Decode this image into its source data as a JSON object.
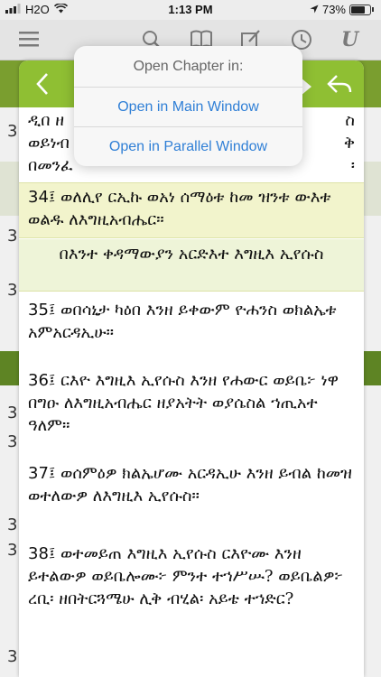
{
  "status": {
    "carrier": "H2O",
    "time": "1:13 PM",
    "battery": "73%"
  },
  "toolbar": {
    "icons": [
      "menu-icon",
      "search-icon",
      "book-icon",
      "edit-icon",
      "history-icon",
      "font-icon"
    ],
    "font_glyph": "U"
  },
  "background": {
    "verse_numbers": [
      "3",
      "3",
      "3",
      "3",
      "3",
      "3",
      "3",
      "3"
    ]
  },
  "panel": {
    "verses": [
      {
        "num": "",
        "text": "ዲበ ዘ… ወይነብ… በመንፈ… ",
        "cut": true
      },
      {
        "num": "34፤",
        "text": "ወለሊየ ርኢኩ ወአነ ሰማዕቱ ከመ ዝንቱ ውእቱ ወልዱ ለእግዚአብሔር።"
      },
      {
        "num": "",
        "text": "በእንተ ቀዳማውያን አርድእተ እግዚእ ኢየሱስ",
        "heading": true
      },
      {
        "num": "35፤",
        "text": "ወበሳኒታ ካዕበ እንዘ ይቀውም ዮሐንስ ወክልኤቱ አምአርዳኢሁ።"
      },
      {
        "num": "36፤",
        "text": "ርእዮ እግዚእ ኢየሱስ እንዘ የሐውር ወይቤ፦ ነዋ በግዑ ለእግዚአብሔር ዘያአትት ወያሴስል ኀጢአተ ዓለም።"
      },
      {
        "num": "37፤",
        "text": "ወሰምዕዎ ክልኤሆሙ አርዳኢሁ እንዘ ይብል ከመዝ ወተለውዎ ለእግዚእ ኢየሱስ።"
      },
      {
        "num": "38፤",
        "text": "ወተመይጠ እግዚእ ኢየሱስ ርእዮሙ እንዘ ይተልውዎ ወይቤሎሙ፦ ምንተ ተኀሥሡ? ወይቤልዎ፦ ረቢ፡ ዘበትርጓሜሁ ሊቅ ብሂል፡ አይቴ ተኀድር?"
      }
    ],
    "cut_line_1": "ዲበ ዘ",
    "cut_line_1_end": "ስ",
    "cut_line_2": "ወይነብ",
    "cut_line_2_end": "ቅ",
    "cut_line_3": "በመንፈ",
    "cut_line_3_end": "፡"
  },
  "popover": {
    "title": "Open Chapter in:",
    "option_main": "Open in Main Window",
    "option_parallel": "Open in Parallel Window"
  },
  "colors": {
    "header_green": "#8fbf33",
    "highlight": "#f2f4cc",
    "link_blue": "#2f7fd6"
  }
}
